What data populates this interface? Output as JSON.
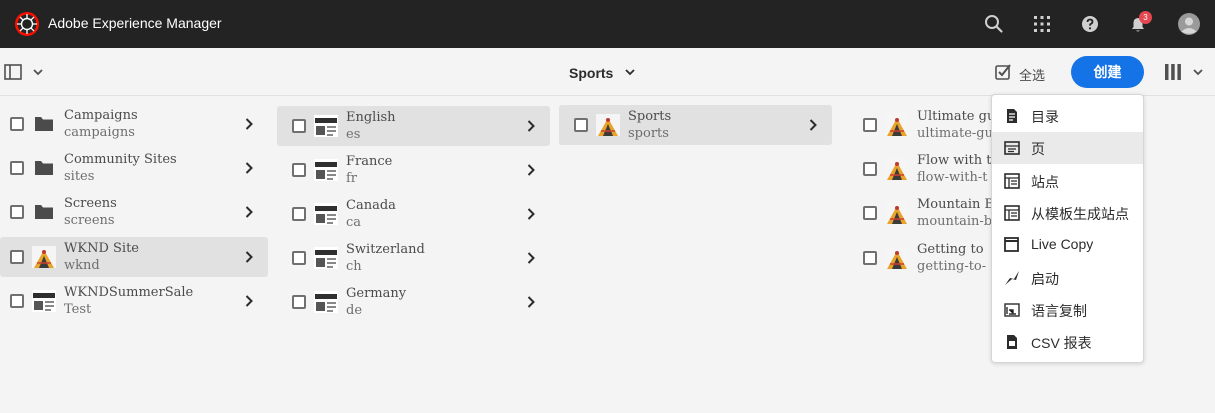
{
  "shell": {
    "app_title": "Adobe Experience Manager",
    "notification_count": "3"
  },
  "actionbar": {
    "title": "Sports",
    "select_all": "全选",
    "create": "创建"
  },
  "columns": [
    {
      "items": [
        {
          "name": "Campaigns",
          "sub": "campaigns",
          "type": "folder"
        },
        {
          "name": "Community Sites",
          "sub": "sites",
          "type": "folder"
        },
        {
          "name": "Screens",
          "sub": "screens",
          "type": "folder"
        },
        {
          "name": "WKND Site",
          "sub": "wknd",
          "type": "site",
          "selected": true
        },
        {
          "name": "WKNDSummerSale",
          "sub": "Test",
          "type": "page"
        }
      ]
    },
    {
      "items": [
        {
          "name": "English",
          "sub": "es",
          "type": "page",
          "selected": true
        },
        {
          "name": "France",
          "sub": "fr",
          "type": "page"
        },
        {
          "name": "Canada",
          "sub": "ca",
          "type": "page"
        },
        {
          "name": "Switzerland",
          "sub": "ch",
          "type": "page"
        },
        {
          "name": "Germany",
          "sub": "de",
          "type": "page"
        }
      ]
    },
    {
      "items": [
        {
          "name": "Sports",
          "sub": "sports",
          "type": "site",
          "selected": true
        }
      ]
    },
    {
      "items": [
        {
          "name": "Ultimate gu",
          "sub": "ultimate-gu",
          "type": "site"
        },
        {
          "name": "Flow with t",
          "sub": "flow-with-t",
          "type": "site"
        },
        {
          "name": "Mountain Bi",
          "sub": "mountain-bi",
          "type": "site"
        },
        {
          "name": "Getting to",
          "sub": "getting-to-",
          "type": "site"
        }
      ]
    }
  ],
  "create_menu": [
    {
      "label": "目录",
      "icon": "catalog-icon"
    },
    {
      "label": "页",
      "icon": "page-icon",
      "highlighted": true
    },
    {
      "label": "站点",
      "icon": "site-icon"
    },
    {
      "label": "从模板生成站点",
      "icon": "site-from-template-icon"
    },
    {
      "label": "Live Copy",
      "icon": "live-copy-icon"
    },
    {
      "label": "启动",
      "icon": "launch-icon"
    },
    {
      "label": "语言复制",
      "icon": "language-copy-icon"
    },
    {
      "label": "CSV 报表",
      "icon": "csv-report-icon"
    }
  ],
  "colors": {
    "shell_bg": "#232323",
    "accent": "#1473e6",
    "badge": "#e34850",
    "selected_row": "#e1e1e1"
  }
}
